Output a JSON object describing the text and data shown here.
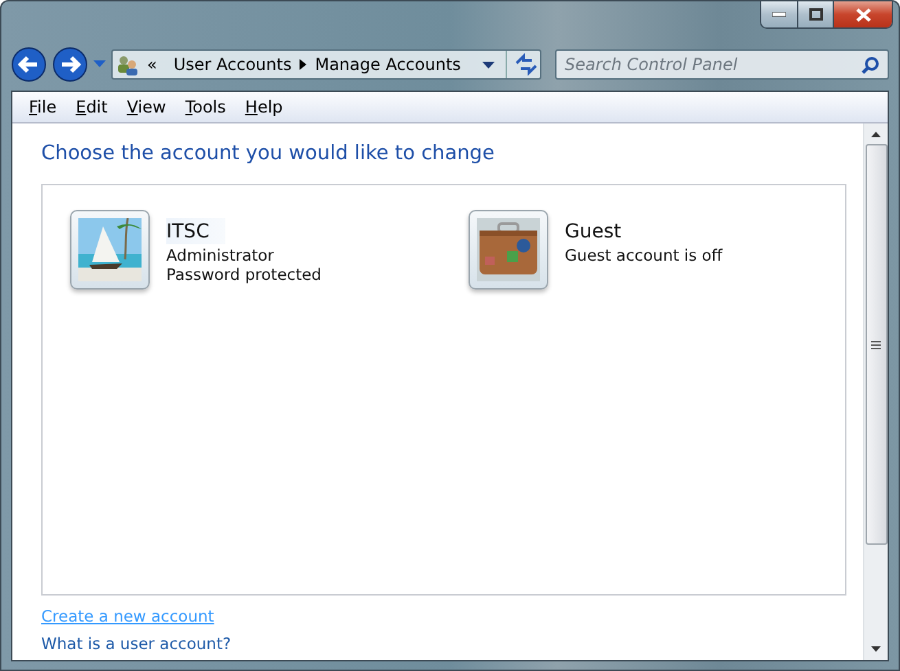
{
  "window": {
    "controls": [
      {
        "kind": "minimize"
      },
      {
        "kind": "maximize"
      },
      {
        "kind": "close"
      }
    ]
  },
  "address_bar": {
    "overflow": "«",
    "crumbs": [
      "User Accounts",
      "Manage Accounts"
    ]
  },
  "search": {
    "placeholder": "Search Control Panel"
  },
  "menu": [
    "File",
    "Edit",
    "View",
    "Tools",
    "Help"
  ],
  "heading": "Choose the account you would like to change",
  "accounts": [
    {
      "name": "ITSC",
      "details": [
        "Administrator",
        "Password protected"
      ],
      "selected": true
    },
    {
      "name": "Guest",
      "details": [
        "Guest account is off"
      ],
      "selected": false
    }
  ],
  "links": [
    {
      "text": "Create a new account",
      "hovered": true
    },
    {
      "text": "What is a user account?",
      "hovered": false
    }
  ]
}
